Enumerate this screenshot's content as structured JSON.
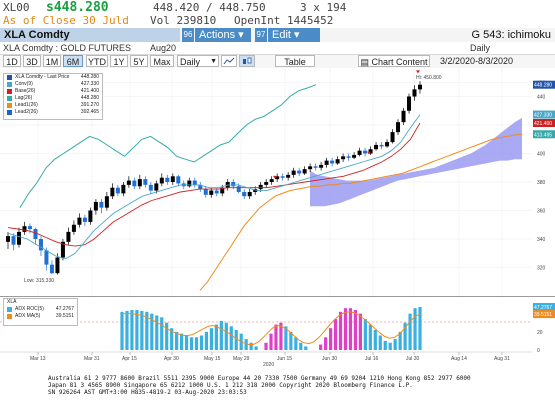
{
  "quote": {
    "symbol": "XL00",
    "last": "s448.280",
    "bid_ask": "448.420 / 448.750",
    "size": "3 x 194",
    "as_of": "As of Close 30 Juld",
    "volume": "Vol   239810",
    "open_interest": "OpenInt   1445452"
  },
  "toolbar": {
    "ticker": "XLA Comdty",
    "actions_num": "96",
    "actions_label": "Actions ▾",
    "edit_num": "97",
    "edit_label": "Edit ▾",
    "title": "G 543: ichimoku"
  },
  "subtitle": {
    "instrument": "XLA Comdty : GOLD FUTURES",
    "contract": "Aug20",
    "periodicity": "Daily"
  },
  "periods": [
    "1D",
    "3D",
    "1M",
    "6M",
    "YTD",
    "1Y",
    "5Y",
    "Max"
  ],
  "active_period": "6M",
  "frequency": "Daily",
  "buttons": {
    "table": "Table",
    "chart_content": "Chart Content",
    "date_range": "3/2/2020-8/3/2020"
  },
  "legend_main": [
    {
      "label": "XLA Comdty - Last Price",
      "value": "448.280",
      "color": "#2255aa"
    },
    {
      "label": "Conv(9)",
      "value": "427.330",
      "color": "#4aa7c8"
    },
    {
      "label": "Base(26)",
      "value": "421.400",
      "color": "#cc2222"
    },
    {
      "label": "Lag(26)",
      "value": "448.280",
      "color": "#33aaaa"
    },
    {
      "label": "Lead1(26)",
      "value": "391.270",
      "color": "#f08c1e"
    },
    {
      "label": "Lead2(26)",
      "value": "392.465",
      "color": "#1a66c8"
    }
  ],
  "legend_sub": {
    "title": "XLA",
    "items": [
      {
        "label": "ADX ROC(5)",
        "value": "47.2767",
        "color": "#3ab0e0"
      },
      {
        "label": "ADX MA(5)",
        "value": "39.5151",
        "color": "#f08c1e"
      }
    ]
  },
  "annotations": {
    "low": "Low: 315.330",
    "hi": "Hi: 450.800"
  },
  "price_axis": {
    "ticks": [
      "450",
      "440",
      "420",
      "400",
      "380",
      "360",
      "340",
      "320"
    ],
    "labels": [
      {
        "text": "448.280",
        "color": "#2255aa"
      },
      {
        "text": "427.330",
        "color": "#4aa7c8"
      },
      {
        "text": "421.400",
        "color": "#cc2222"
      },
      {
        "text": "413.495",
        "color": "#33aaaa"
      }
    ]
  },
  "sub_axis": {
    "ticks": [
      "40",
      "20",
      "0"
    ],
    "labels": [
      {
        "text": "47.2767",
        "color": "#3ab0e0"
      },
      {
        "text": "39.5151",
        "color": "#f08c1e"
      }
    ]
  },
  "x_axis": {
    "ticks": [
      "Mar 13",
      "Mar 31",
      "Apr 15",
      "Apr 30",
      "May 15",
      "May 29",
      "Jun 15",
      "Jun 30",
      "Jul 16",
      "Jul 30",
      "Aug 14",
      "Aug 31"
    ],
    "year": "2020"
  },
  "footer": {
    "line1": "Australia 61 2 9777 8600 Brazil 5511 2395 9000 Europe 44 20 7330 7500 Germany 49 69 9204 1210 Hong Kong 852 2977 6000",
    "line2": "Japan 81 3 4565 8900        Singapore 65 6212 1000    U.S. 1 212 318 2000         Copyright 2020 Bloomberg Finance L.P.",
    "line3": "SN 926264 AST  GMT+3:00 H835-4819-2 03-Aug-2020 23:03:53"
  },
  "chart_data": {
    "type": "line",
    "title": "XLA Comdty : GOLD FUTURES (Ichimoku, Daily)",
    "xlabel": "",
    "ylabel": "",
    "x": [
      "Mar 13",
      "Mar 31",
      "Apr 15",
      "Apr 30",
      "May 15",
      "May 29",
      "Jun 15",
      "Jun 30",
      "Jul 16",
      "Jul 30"
    ],
    "ylim": [
      310,
      455
    ],
    "series": [
      {
        "name": "XLA Comdty - Last Price",
        "values": [
          316,
          345,
          370,
          378,
          380,
          373,
          384,
          392,
          408,
          448.28
        ]
      },
      {
        "name": "Conv(9)",
        "values": [
          340,
          352,
          368,
          376,
          378,
          378,
          382,
          388,
          400,
          427.33
        ]
      },
      {
        "name": "Base(26)",
        "values": [
          345,
          348,
          362,
          372,
          376,
          378,
          379,
          384,
          395,
          421.4
        ]
      },
      {
        "name": "Lag(26)",
        "values": [
          380,
          395,
          410,
          425,
          405,
          395,
          400,
          425,
          448.28,
          null
        ]
      },
      {
        "name": "Lead1(26)",
        "values": [
          null,
          null,
          null,
          null,
          340,
          365,
          372,
          380,
          390,
          413.495
        ]
      },
      {
        "name": "Lead2(26)",
        "values": [
          null,
          null,
          null,
          null,
          362,
          362,
          372,
          380,
          392,
          392.465
        ]
      }
    ],
    "sub_chart": {
      "type": "bar",
      "series": [
        {
          "name": "ADX ROC(5)",
          "values": [
            40,
            25,
            20,
            15,
            20,
            30,
            15,
            8,
            35,
            47.2767
          ]
        },
        {
          "name": "ADX MA(5)",
          "values": [
            35,
            25,
            22,
            18,
            20,
            25,
            18,
            10,
            30,
            39.5151
          ]
        }
      ],
      "ylim": [
        0,
        50
      ]
    }
  }
}
